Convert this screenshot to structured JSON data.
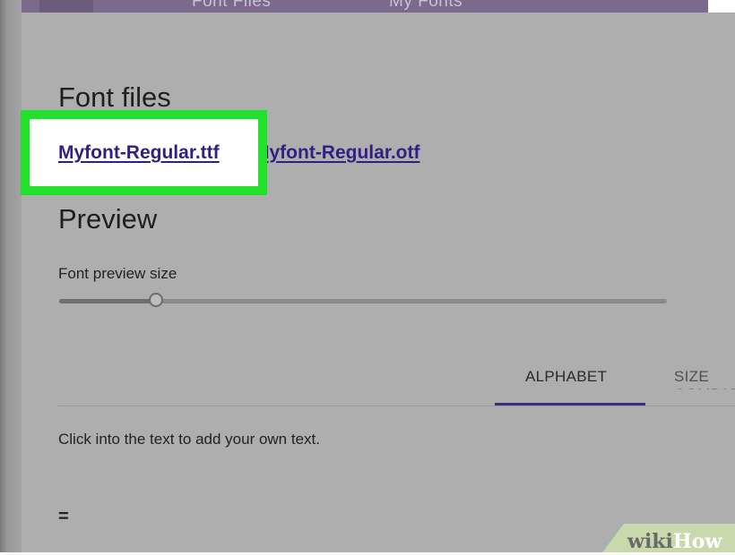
{
  "top_tabs": [
    "Font Files",
    "My Fonts"
  ],
  "font_files": {
    "title": "Font files",
    "files": [
      "Myfont-Regular.ttf",
      "Myfont-Regular.otf"
    ]
  },
  "preview": {
    "title": "Preview",
    "size_label": "Font preview size",
    "slider_value": 0.16,
    "tabs": [
      "ALPHABET",
      "SIZE COMPARISON"
    ],
    "active_tab": "ALPHABET",
    "hint": "Click into the text to add your own text.",
    "sample_text": "="
  },
  "colors": {
    "highlight": "#22e12b",
    "link": "#331f82",
    "tab_underline": "#3c2a86",
    "top_bar": "#7c6a8d"
  },
  "watermark": {
    "wiki": "wiki",
    "how": "How"
  }
}
